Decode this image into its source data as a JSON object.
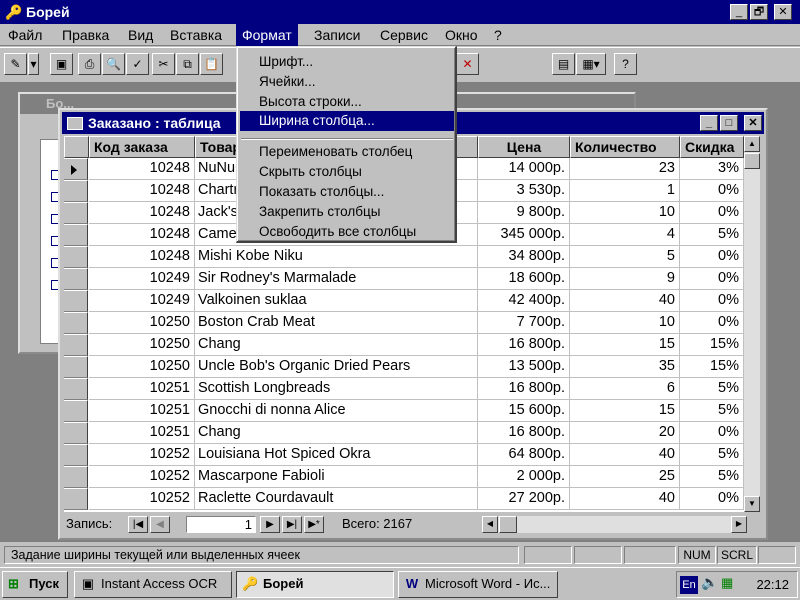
{
  "app": {
    "title": "Борей",
    "icon": "key-icon",
    "caption_buttons": [
      "_",
      "🗗",
      "✕"
    ]
  },
  "menubar": [
    {
      "label": "Файл"
    },
    {
      "label": "Правка"
    },
    {
      "label": "Вид"
    },
    {
      "label": "Вставка"
    },
    {
      "label": "Формат"
    },
    {
      "label": "Записи"
    },
    {
      "label": "Сервис"
    },
    {
      "label": "Окно"
    },
    {
      "label": "?"
    }
  ],
  "toolbar": {
    "icons": [
      "design-view-icon",
      "dropdown-arrow-icon",
      "save-icon",
      "print-icon",
      "print-preview-icon",
      "spelling-icon",
      "cut-icon",
      "copy-icon",
      "paste-icon",
      "delete-record-icon",
      "database-window-icon",
      "new-object-icon",
      "help-icon"
    ]
  },
  "db_window": {
    "title": "Бо..."
  },
  "table_window": {
    "title": "Заказано : таблица",
    "columns": [
      "Код заказа",
      "Товар",
      "Цена",
      "Количество",
      "Скидка"
    ],
    "rows": [
      [
        "10248",
        "NuNuCa Nuß-Nougat-Creme",
        "14 000р.",
        "23",
        "3%"
      ],
      [
        "10248",
        "Chartreuse verte",
        "3 530р.",
        "1",
        "0%"
      ],
      [
        "10248",
        "Jack's New England Clam Chowder",
        "9 800р.",
        "10",
        "0%"
      ],
      [
        "10248",
        "Camembert Pierrot",
        "345 000р.",
        "4",
        "5%"
      ],
      [
        "10248",
        "Mishi Kobe Niku",
        "34 800р.",
        "5",
        "0%"
      ],
      [
        "10249",
        "Sir Rodney's Marmalade",
        "18 600р.",
        "9",
        "0%"
      ],
      [
        "10249",
        "Valkoinen suklaa",
        "42 400р.",
        "40",
        "0%"
      ],
      [
        "10250",
        "Boston Crab Meat",
        "7 700р.",
        "10",
        "0%"
      ],
      [
        "10250",
        "Chang",
        "16 800р.",
        "15",
        "15%"
      ],
      [
        "10250",
        "Uncle Bob's Organic Dried Pears",
        "13 500р.",
        "35",
        "15%"
      ],
      [
        "10251",
        "Scottish Longbreads",
        "16 800р.",
        "6",
        "5%"
      ],
      [
        "10251",
        "Gnocchi di nonna Alice",
        "15 600р.",
        "15",
        "5%"
      ],
      [
        "10251",
        "Chang",
        "16 800р.",
        "20",
        "0%"
      ],
      [
        "10252",
        "Louisiana Hot Spiced Okra",
        "64 800р.",
        "40",
        "5%"
      ],
      [
        "10252",
        "Mascarpone Fabioli",
        "2 000р.",
        "25",
        "5%"
      ],
      [
        "10252",
        "Raclette Courdavault",
        "27 200р.",
        "40",
        "0%"
      ]
    ],
    "nav": {
      "label": "Запись:",
      "current": "1",
      "total": "Всего: 2167"
    }
  },
  "format_menu": {
    "items": [
      {
        "label": "Шрифт..."
      },
      {
        "label": "Ячейки..."
      },
      {
        "label": "Высота строки..."
      },
      {
        "label": "Ширина столбца..."
      },
      {
        "label": "Переименовать столбец"
      },
      {
        "label": "Скрыть столбцы"
      },
      {
        "label": "Показать столбцы..."
      },
      {
        "label": "Закрепить столбцы"
      },
      {
        "label": "Освободить все столбцы"
      }
    ]
  },
  "statusbar": {
    "text": "Задание ширины текущей или выделенных ячеек",
    "num": "NUM",
    "scrl": "SCRL"
  },
  "taskbar": {
    "start": "Пуск",
    "tasks": [
      {
        "label": "Instant Access OCR"
      },
      {
        "label": "Борей"
      },
      {
        "label": "Microsoft Word - Ис..."
      }
    ],
    "lang": "En",
    "clock": "22:12"
  }
}
